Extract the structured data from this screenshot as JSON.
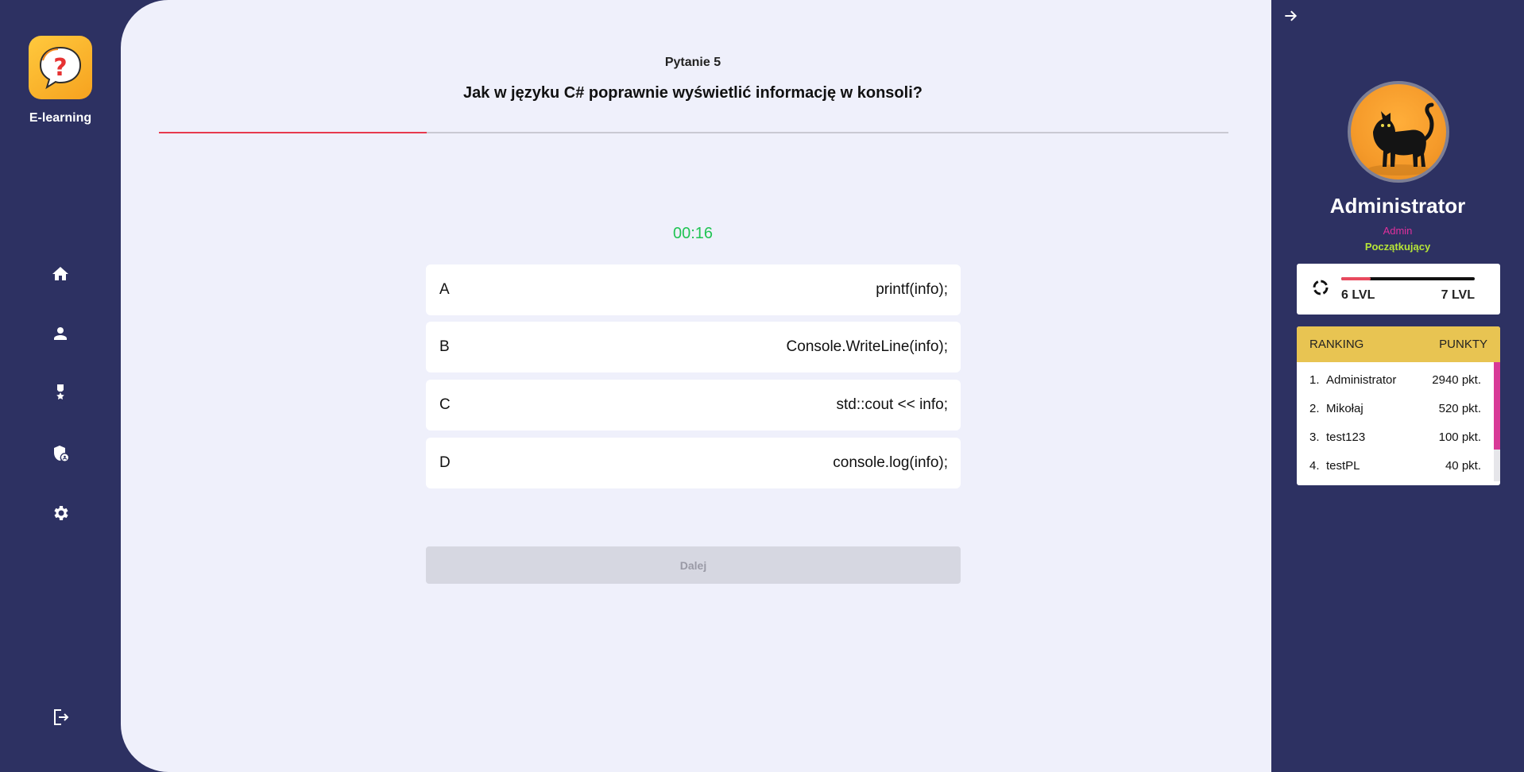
{
  "app": {
    "name": "E-learning"
  },
  "nav": {
    "items": [
      {
        "icon": "home-icon"
      },
      {
        "icon": "user-icon"
      },
      {
        "icon": "medal-icon"
      },
      {
        "icon": "admin-shield-icon"
      },
      {
        "icon": "gear-icon"
      },
      {
        "icon": "logout-icon"
      }
    ]
  },
  "quiz": {
    "question_number": "Pytanie 5",
    "question": "Jak w języku C# poprawnie wyświetlić informację w konsoli?",
    "progress": 0.25,
    "timer": "00:16",
    "answers": [
      {
        "letter": "A",
        "text": "printf(info);"
      },
      {
        "letter": "B",
        "text": "Console.WriteLine(info);"
      },
      {
        "letter": "C",
        "text": "std::cout << info;"
      },
      {
        "letter": "D",
        "text": "console.log(info);"
      }
    ],
    "next_label": "Dalej"
  },
  "profile": {
    "name": "Administrator",
    "role": "Admin",
    "rank": "Początkujący",
    "level_from": "6 LVL",
    "level_to": "7 LVL",
    "level_progress": 0.22
  },
  "ranking": {
    "header_left": "RANKING",
    "header_right": "PUNKTY",
    "rows": [
      {
        "pos": "1.",
        "name": "Administrator",
        "points": "2940 pkt."
      },
      {
        "pos": "2.",
        "name": "Mikołaj",
        "points": "520 pkt."
      },
      {
        "pos": "3.",
        "name": "test123",
        "points": "100 pkt."
      },
      {
        "pos": "4.",
        "name": "testPL",
        "points": "40 pkt."
      }
    ]
  },
  "colors": {
    "sidebar": "#2d3162",
    "main_bg": "#eff0fb",
    "progress": "#e73a4e",
    "timer": "#21c454",
    "role": "#e0309c",
    "rank": "#b7e637",
    "ranking_header": "#e8c452"
  }
}
